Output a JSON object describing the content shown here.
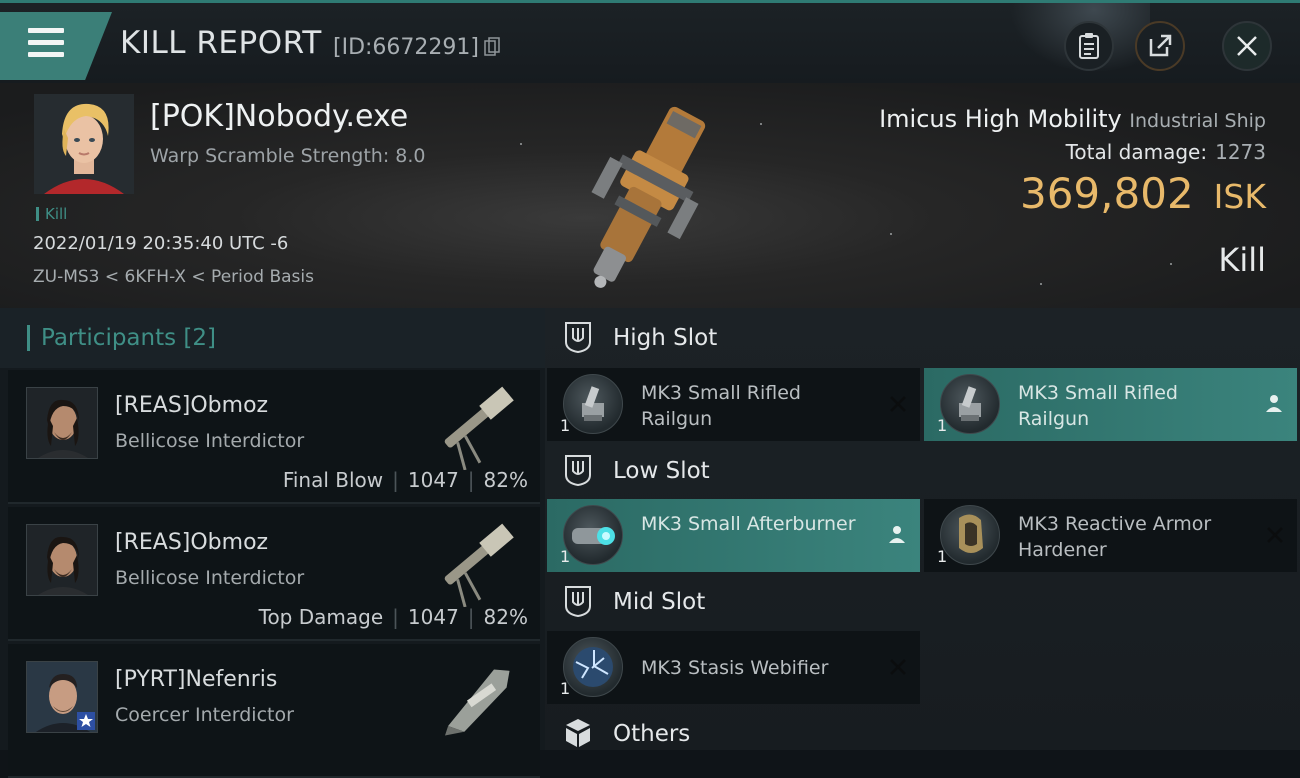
{
  "header": {
    "title": "KILL REPORT",
    "report_id": "[ID:6672291]",
    "buttons": {
      "menu": "menu-icon",
      "clipboard": "clipboard-icon",
      "share": "share-icon",
      "close": "close-icon"
    }
  },
  "victim": {
    "name": "[POK]Nobody.exe",
    "warp_scramble": "Warp Scramble Strength: 8.0",
    "tag": "Kill",
    "datetime": "2022/01/19 20:35:40 UTC -6",
    "location": "ZU-MS3 < 6KFH-X < Period Basis",
    "ship_name": "Imicus High Mobility",
    "ship_class": "Industrial Ship",
    "total_damage_label": "Total damage:",
    "total_damage": "1273",
    "isk_value": "369,802",
    "isk_unit": "ISK",
    "result": "Kill"
  },
  "participants": {
    "header": "Participants",
    "count": "[2]",
    "rows": [
      {
        "name": "[REAS]Obmoz",
        "ship": "Bellicose Interdictor",
        "role": "Final Blow",
        "damage": "1047",
        "percent": "82%"
      },
      {
        "name": "[REAS]Obmoz",
        "ship": "Bellicose Interdictor",
        "role": "Top Damage",
        "damage": "1047",
        "percent": "82%"
      },
      {
        "name": "[PYRT]Nefenris",
        "ship": "Coercer Interdictor"
      }
    ]
  },
  "fittings": {
    "high": {
      "title": "High Slot",
      "modules": [
        {
          "name": "MK3 Small Rifled Railgun",
          "qty": "1",
          "state": "destroyed"
        },
        {
          "name": "MK3 Small Rifled Railgun",
          "qty": "1",
          "state": "dropped"
        }
      ]
    },
    "low": {
      "title": "Low Slot",
      "modules": [
        {
          "name": "MK3 Small Afterburner",
          "qty": "1",
          "state": "dropped"
        },
        {
          "name": "MK3 Reactive Armor Hardener",
          "qty": "1",
          "state": "destroyed"
        }
      ]
    },
    "mid": {
      "title": "Mid Slot",
      "modules": [
        {
          "name": "MK3 Stasis Webifier",
          "qty": "1",
          "state": "destroyed"
        }
      ]
    },
    "others": {
      "title": "Others"
    }
  },
  "colors": {
    "accent": "#3f8f86",
    "isk": "#e8b96a",
    "highlight": "#3b847d"
  }
}
